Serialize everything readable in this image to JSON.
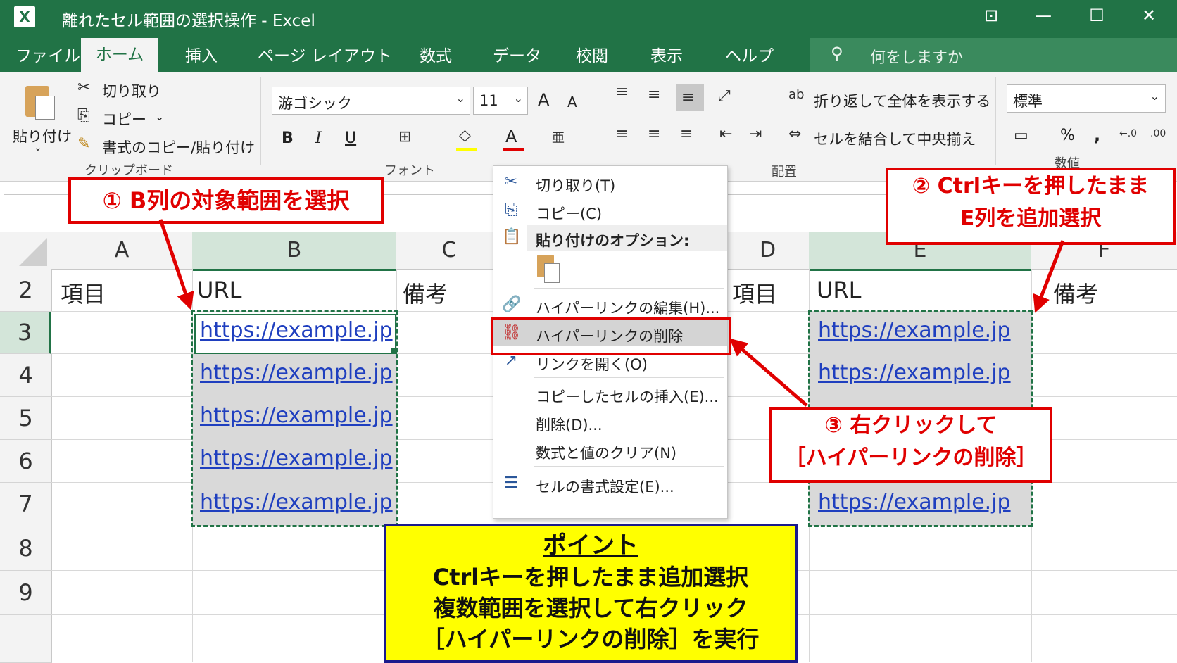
{
  "window": {
    "title": "離れたセル範囲の選択操作  -  Excel",
    "app_logo": "X",
    "buttons": [
      "ribbon-display-icon",
      "minimize-icon",
      "maximize-icon",
      "close-icon"
    ]
  },
  "tabs": [
    "ファイル",
    "ホーム",
    "挿入",
    "ページ レイアウト",
    "数式",
    "データ",
    "校閲",
    "表示",
    "ヘルプ"
  ],
  "tell_me": "何をしますか",
  "ribbon": {
    "clipboard": {
      "paste": "貼り付け",
      "cut": "切り取り",
      "copy": "コピー",
      "format_painter": "書式のコピー/貼り付け",
      "label": "クリップボード"
    },
    "font": {
      "name": "游ゴシック",
      "size": "11",
      "grow": "A",
      "shrink": "A",
      "bold": "B",
      "italic": "I",
      "underline": "U",
      "font_color_letter": "A",
      "label": "フォント"
    },
    "alignment": {
      "wrap_text": "折り返して全体を表示する",
      "merge_center": "セルを結合して中央揃え",
      "label": "配置"
    },
    "number": {
      "format": "標準",
      "percent": "%",
      "comma": ",",
      "label": "数値"
    }
  },
  "columns": [
    "A",
    "B",
    "C",
    "D",
    "E",
    "F"
  ],
  "rows": [
    "2",
    "3",
    "4",
    "5",
    "6",
    "7",
    "8",
    "9"
  ],
  "cells": {
    "A2": "項目",
    "B2": "URL",
    "C2": "備考",
    "D2": "項目",
    "E2": "URL",
    "F2": "備考",
    "B3": "https://example.jp",
    "B4": "https://example.jp",
    "B5": "https://example.jp",
    "B6": "https://example.jp",
    "B7": "https://example.jp",
    "E3": "https://example.jp",
    "E4": "https://example.jp",
    "E7": "https://example.jp"
  },
  "context_menu": {
    "cut": "切り取り(T)",
    "copy": "コピー(C)",
    "paste_options": "貼り付けのオプション:",
    "edit_hyperlink": "ハイパーリンクの編集(H)...",
    "remove_hyperlink": "ハイパーリンクの削除",
    "open_link": "リンクを開く(O)",
    "insert_copied": "コピーしたセルの挿入(E)...",
    "delete": "削除(D)...",
    "clear_contents": "数式と値のクリア(N)",
    "format_cells": "セルの書式設定(E)..."
  },
  "callouts": {
    "step1": "① B列の対象範囲を選択",
    "step2_line1": "② Ctrlキーを押したまま",
    "step2_line2": "E列を追加選択",
    "step3_line1": "③ 右クリックして",
    "step3_line2": "［ハイパーリンクの削除］",
    "point_title": "ポイント",
    "point_line1": "Ctrlキーを押したまま追加選択",
    "point_line2": "複数範囲を選択して右クリック",
    "point_line3": "［ハイパーリンクの削除］を実行"
  },
  "colors": {
    "excel_green": "#217346",
    "callout_red": "#e00000",
    "point_yellow": "#ffff00",
    "link_blue": "#1f3fbf"
  }
}
